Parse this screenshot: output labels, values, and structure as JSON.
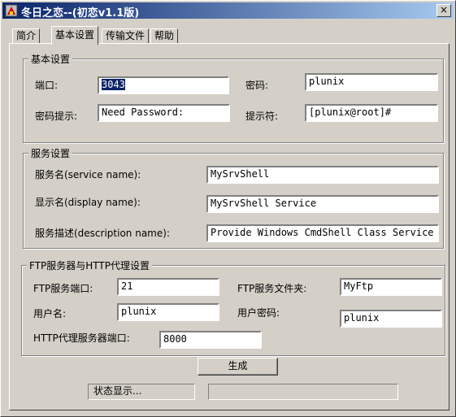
{
  "window": {
    "title": "冬日之恋--(初恋v1.1版)",
    "close_glyph": "×"
  },
  "tabs": [
    "简介",
    "基本设置",
    "传输文件",
    "帮助"
  ],
  "active_tab": "基本设置",
  "basic": {
    "legend": "基本设置",
    "port_label": "端口:",
    "port_value": "3043",
    "password_label": "密码:",
    "password_value": "plunix",
    "hint_label": "密码提示:",
    "hint_value": "Need Password:",
    "prompt_label": "提示符:",
    "prompt_value": "[plunix@root]#"
  },
  "service": {
    "legend": "服务设置",
    "name_label": "服务名(service name):",
    "name_value": "MySrvShell",
    "display_label": "显示名(display name):",
    "display_value": "MySrvShell Service",
    "desc_label": "服务描述(description name):",
    "desc_value": "Provide Windows CmdShell Class Service"
  },
  "ftp": {
    "legend": "FTP服务器与HTTP代理设置",
    "port_label": "FTP服务端口:",
    "port_value": "21",
    "folder_label": "FTP服务文件夹:",
    "folder_value": "MyFtp",
    "user_label": "用户名:",
    "user_value": "plunix",
    "pass_label": "用户密码:",
    "pass_value": "plunix",
    "http_label": "HTTP代理服务器端口:",
    "http_value": "8000"
  },
  "generate_label": "生成",
  "status_label": "状态显示...",
  "status_value": ""
}
